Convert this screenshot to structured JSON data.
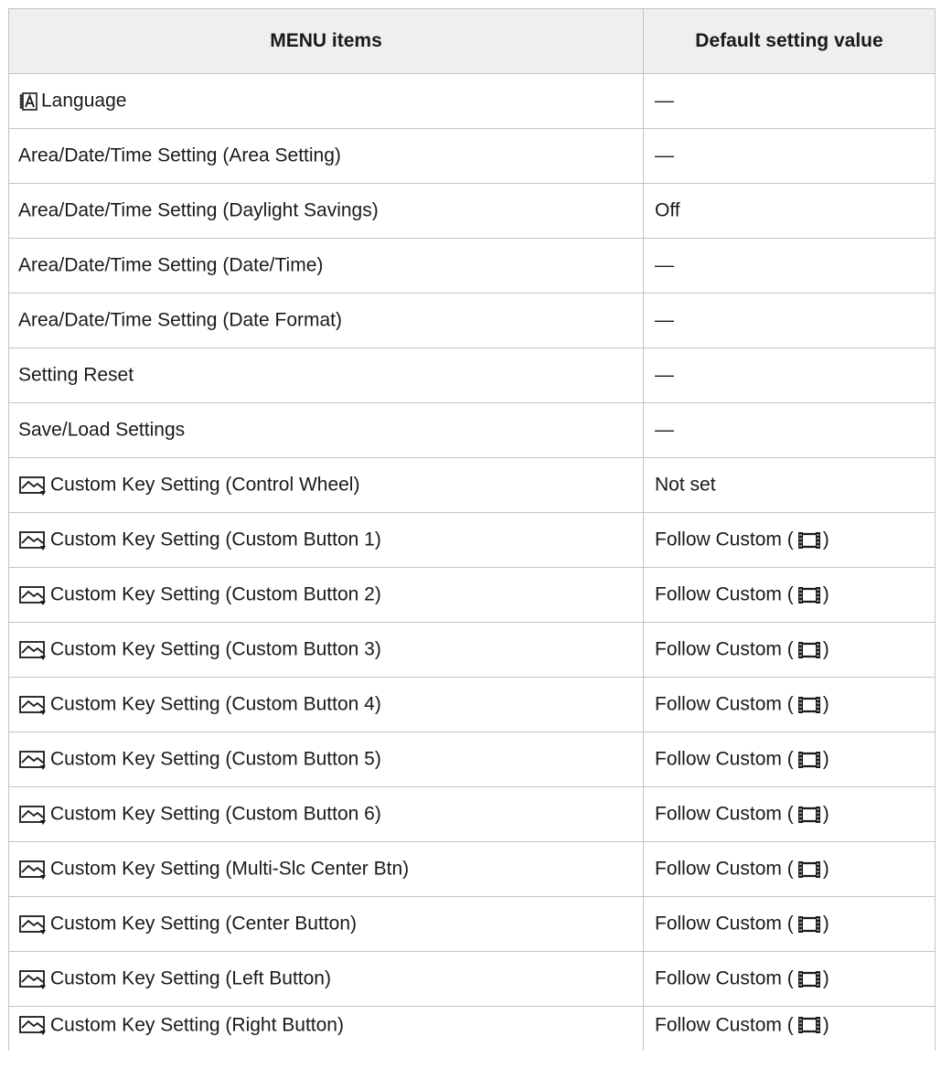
{
  "table": {
    "headers": [
      "MENU items",
      "Default setting value"
    ],
    "rows": [
      {
        "icon": "language-icon",
        "item": "Language",
        "value": "—"
      },
      {
        "icon": "",
        "item": "Area/Date/Time Setting (Area Setting)",
        "value": "—"
      },
      {
        "icon": "",
        "item": "Area/Date/Time Setting (Daylight Savings)",
        "value": "Off"
      },
      {
        "icon": "",
        "item": "Area/Date/Time Setting (Date/Time)",
        "value": "—"
      },
      {
        "icon": "",
        "item": "Area/Date/Time Setting (Date Format)",
        "value": "—"
      },
      {
        "icon": "",
        "item": "Setting Reset",
        "value": "—"
      },
      {
        "icon": "",
        "item": "Save/Load Settings",
        "value": "—"
      },
      {
        "icon": "custom-key-photo-icon",
        "item": "Custom Key Setting (Control Wheel)",
        "value": "Not set"
      },
      {
        "icon": "custom-key-photo-icon",
        "item": "Custom Key Setting (Custom Button 1)",
        "value": "Follow Custom (",
        "value_icon": "movie-icon",
        "value_suffix": ")"
      },
      {
        "icon": "custom-key-photo-icon",
        "item": "Custom Key Setting (Custom Button 2)",
        "value": "Follow Custom (",
        "value_icon": "movie-icon",
        "value_suffix": ")"
      },
      {
        "icon": "custom-key-photo-icon",
        "item": "Custom Key Setting (Custom Button 3)",
        "value": "Follow Custom (",
        "value_icon": "movie-icon",
        "value_suffix": ")"
      },
      {
        "icon": "custom-key-photo-icon",
        "item": "Custom Key Setting (Custom Button 4)",
        "value": "Follow Custom (",
        "value_icon": "movie-icon",
        "value_suffix": ")"
      },
      {
        "icon": "custom-key-photo-icon",
        "item": "Custom Key Setting (Custom Button 5)",
        "value": "Follow Custom (",
        "value_icon": "movie-icon",
        "value_suffix": ")"
      },
      {
        "icon": "custom-key-photo-icon",
        "item": "Custom Key Setting (Custom Button 6)",
        "value": "Follow Custom (",
        "value_icon": "movie-icon",
        "value_suffix": ")"
      },
      {
        "icon": "custom-key-photo-icon",
        "item": "Custom Key Setting (Multi-Slc Center Btn)",
        "value": "Follow Custom (",
        "value_icon": "movie-icon",
        "value_suffix": ")"
      },
      {
        "icon": "custom-key-photo-icon",
        "item": "Custom Key Setting (Center Button)",
        "value": "Follow Custom (",
        "value_icon": "movie-icon",
        "value_suffix": ")"
      },
      {
        "icon": "custom-key-photo-icon",
        "item": "Custom Key Setting (Left Button)",
        "value": "Follow Custom (",
        "value_icon": "movie-icon",
        "value_suffix": ")"
      },
      {
        "icon": "custom-key-photo-icon",
        "item": "Custom Key Setting (Right Button)",
        "value": "Follow Custom (",
        "value_icon": "movie-icon",
        "value_suffix": ")"
      }
    ]
  },
  "colors": {
    "header_bg": "#efefef",
    "border": "#c4c4c4",
    "text": "#1a1a1a"
  }
}
